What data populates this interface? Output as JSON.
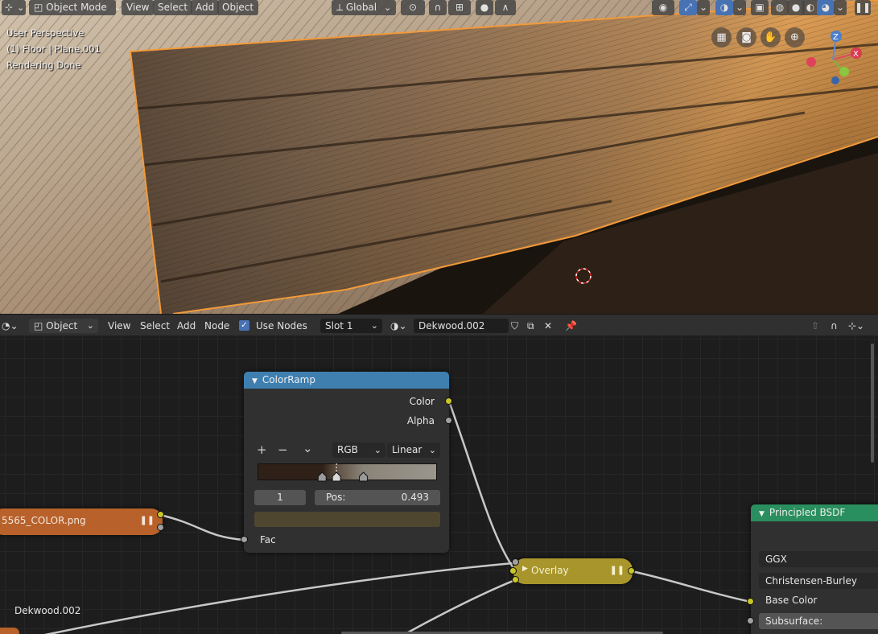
{
  "viewport_header": {
    "editor_icon": "view3d-editor-icon",
    "mode": "Object Mode",
    "menus": [
      "View",
      "Select",
      "Add",
      "Object"
    ],
    "orientation": "Global"
  },
  "viewport_info": {
    "line1": "User Perspective",
    "line2": "(1) Floor | Plane.001",
    "line3": "Rendering Done"
  },
  "gizmo": {
    "z_label": "Z",
    "x_label": "X"
  },
  "node_header": {
    "mode": "Object",
    "menus": [
      "View",
      "Select",
      "Add",
      "Node"
    ],
    "use_nodes_label": "Use Nodes",
    "slot": "Slot 1",
    "material": "Dekwood.002"
  },
  "nodes": {
    "image_texture": {
      "title": "5565_COLOR.png"
    },
    "colorramp": {
      "title": "ColorRamp",
      "outputs": [
        "Color",
        "Alpha"
      ],
      "add_symbol": "+",
      "remove_symbol": "−",
      "menu_symbol": "⌄",
      "color_mode": "RGB",
      "interpolation": "Linear",
      "active_index": "1",
      "pos_label": "Pos:",
      "pos_value": "0.493",
      "input": "Fac",
      "stops": [
        0.36,
        0.44,
        0.59
      ]
    },
    "overlay": {
      "title": "Overlay"
    },
    "principled": {
      "title": "Principled BSDF",
      "distribution": "GGX",
      "subsurface_method": "Christensen-Burley",
      "base_color_label": "Base Color",
      "subsurface_label": "Subsurface:"
    },
    "frame_label": "Dekwood.002"
  },
  "colors": {
    "accent": "#4772b3",
    "colorramp_header": "#3e7fb0",
    "bsdf_header": "#2a8f5e",
    "image_node": "#b8612a",
    "overlay_node": "#a8962c",
    "selection_outline": "#f29a3a",
    "socket_yellow": "#c7c729"
  }
}
